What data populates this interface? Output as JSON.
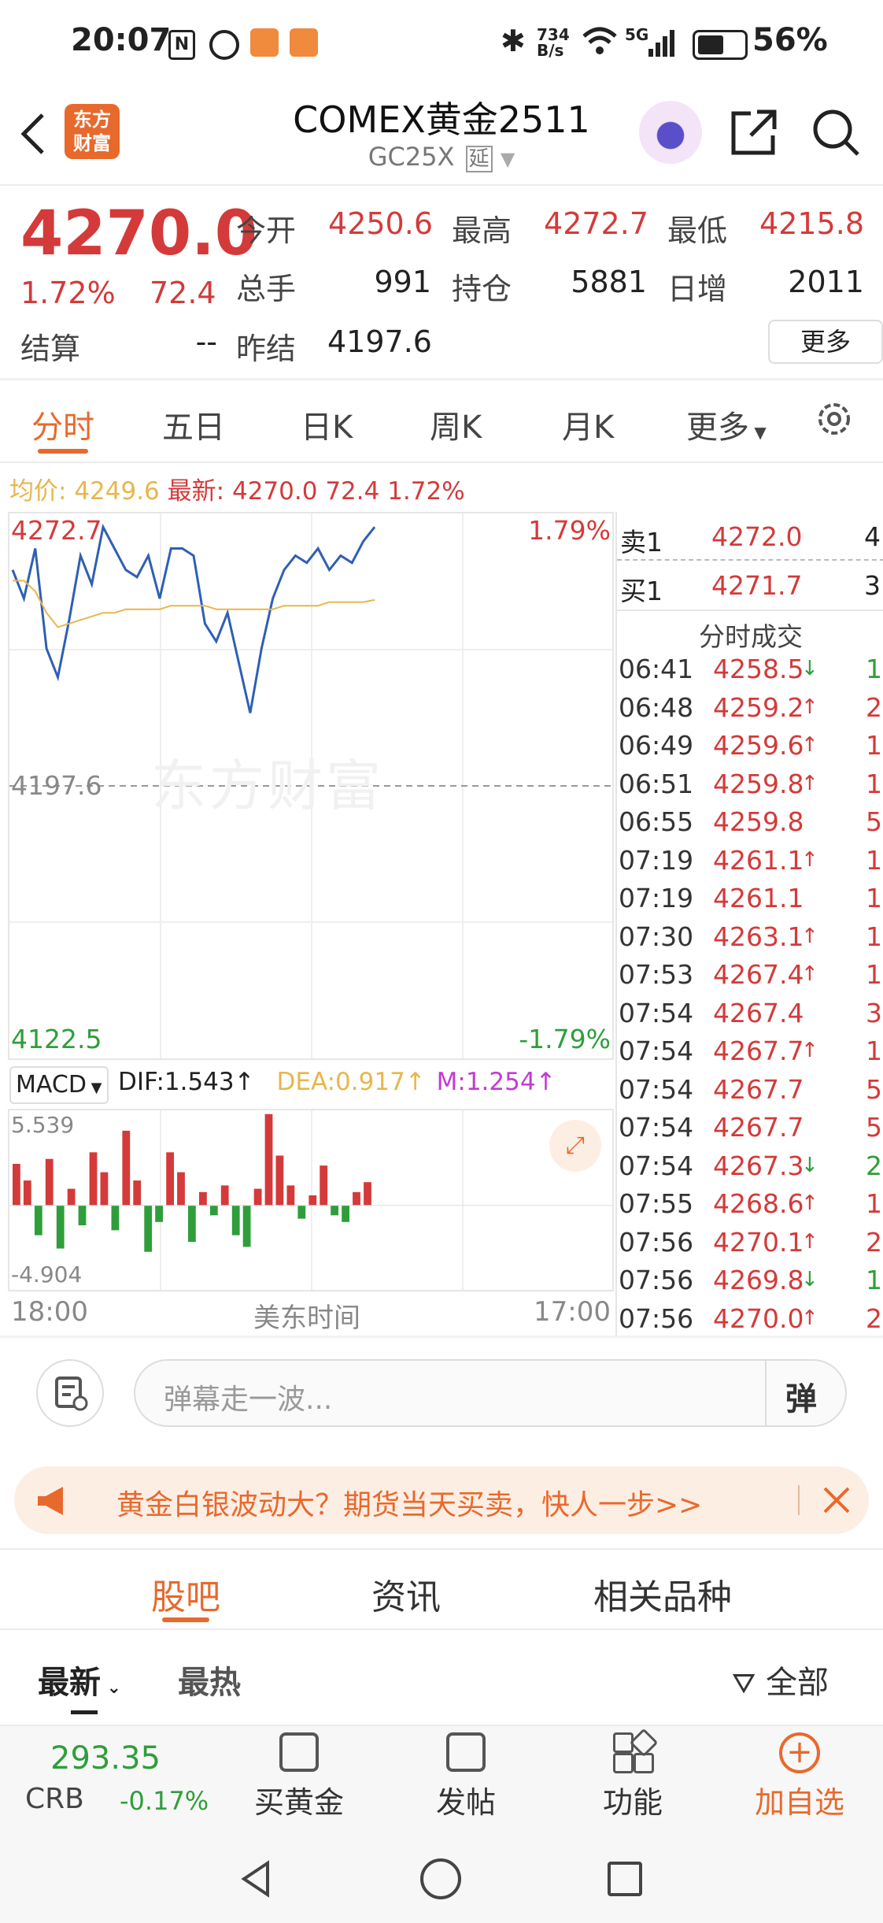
{
  "status_bar": {
    "time": "20:07",
    "speed_top": "734",
    "speed_unit": "B/s",
    "network": "5G",
    "battery": "56%"
  },
  "header": {
    "title": "COMEX黄金2511",
    "subtitle": "GC25X",
    "delay_badge": "延",
    "logo_line1": "东方",
    "logo_line2": "财富"
  },
  "quote": {
    "price": "4270.0",
    "change_pct": "1.72%",
    "change": "72.4",
    "settle_label": "结算",
    "settle_value": "--",
    "prev_settle_label": "昨结",
    "prev_settle_value": "4197.6",
    "open_label": "今开",
    "open_value": "4250.6",
    "high_label": "最高",
    "high_value": "4272.7",
    "low_label": "最低",
    "low_value": "4215.8",
    "volume_label": "总手",
    "volume_value": "991",
    "oi_label": "持仓",
    "oi_value": "5881",
    "daily_inc_label": "日增",
    "daily_inc_value": "2011",
    "more_button": "更多"
  },
  "tabs": [
    "分时",
    "五日",
    "日K",
    "周K",
    "月K",
    "更多"
  ],
  "info_line": {
    "avg_label": "均价:",
    "avg_value": "4249.6",
    "latest_label": "最新:",
    "latest_value": "4270.0",
    "change": "72.4",
    "change_pct": "1.72%"
  },
  "chart": {
    "top_price": "4272.7",
    "top_pct": "1.79%",
    "mid_price": "4197.6",
    "bottom_price": "4122.5",
    "bottom_pct": "-1.79%",
    "watermark": "东方财富",
    "x_start": "18:00",
    "x_mid": "美东时间",
    "x_end": "17:00"
  },
  "macd": {
    "selector": "MACD",
    "dif": "DIF:1.543",
    "dea": "DEA:0.917",
    "m": "M:1.254",
    "top": "5.539",
    "bottom": "-4.904"
  },
  "chart_data": {
    "type": "line",
    "title": "",
    "xlabel": "美东时间",
    "ylabel": "",
    "ylim": [
      4122.5,
      4272.7
    ],
    "reference_line": 4197.6,
    "series": [
      {
        "name": "最新",
        "values": [
          4258,
          4250,
          4264,
          4236,
          4228,
          4244,
          4262,
          4254,
          4270,
          4264,
          4258,
          4256,
          4262,
          4250,
          4264,
          4264,
          4262,
          4243,
          4238,
          4246,
          4232,
          4218,
          4236,
          4250,
          4258,
          4262,
          4260,
          4264,
          4258,
          4262,
          4260,
          4266,
          4270
        ]
      },
      {
        "name": "均价",
        "values": [
          4255,
          4255,
          4252,
          4246,
          4242,
          4243,
          4244,
          4245,
          4246,
          4246,
          4247,
          4247,
          4247,
          4247,
          4248,
          4248,
          4248,
          4248,
          4247,
          4247,
          4247,
          4247,
          4247,
          4247,
          4248,
          4248,
          4248,
          4248,
          4249,
          4249,
          4249,
          4249,
          4249.6
        ]
      }
    ],
    "macd_ylim": [
      -4.904,
      5.539
    ],
    "macd_bars": [
      2.5,
      1.5,
      -1.8,
      2.8,
      -2.6,
      1.0,
      -1.2,
      3.2,
      2.0,
      -1.5,
      4.5,
      1.5,
      -2.8,
      -1.0,
      3.2,
      2.0,
      -2.2,
      0.8,
      -0.6,
      1.2,
      -1.8,
      -2.5,
      1.0,
      5.5,
      3.0,
      1.2,
      -0.8,
      0.6,
      2.4,
      -0.6,
      -1.0,
      0.8,
      1.4
    ]
  },
  "order_book": {
    "ask_label": "卖1",
    "ask_price": "4272.0",
    "ask_vol": "4",
    "bid_label": "买1",
    "bid_price": "4271.7",
    "bid_vol": "3",
    "trades_title": "分时成交"
  },
  "trades": [
    {
      "time": "06:41",
      "price": "4258.5",
      "dir": "↓",
      "vol": "1"
    },
    {
      "time": "06:48",
      "price": "4259.2",
      "dir": "↑",
      "vol": "2"
    },
    {
      "time": "06:49",
      "price": "4259.6",
      "dir": "↑",
      "vol": "1"
    },
    {
      "time": "06:51",
      "price": "4259.8",
      "dir": "↑",
      "vol": "1"
    },
    {
      "time": "06:55",
      "price": "4259.8",
      "dir": "",
      "vol": "5"
    },
    {
      "time": "07:19",
      "price": "4261.1",
      "dir": "↑",
      "vol": "1"
    },
    {
      "time": "07:19",
      "price": "4261.1",
      "dir": "",
      "vol": "1"
    },
    {
      "time": "07:30",
      "price": "4263.1",
      "dir": "↑",
      "vol": "1"
    },
    {
      "time": "07:53",
      "price": "4267.4",
      "dir": "↑",
      "vol": "1"
    },
    {
      "time": "07:54",
      "price": "4267.4",
      "dir": "",
      "vol": "3"
    },
    {
      "time": "07:54",
      "price": "4267.7",
      "dir": "↑",
      "vol": "1"
    },
    {
      "time": "07:54",
      "price": "4267.7",
      "dir": "",
      "vol": "5"
    },
    {
      "time": "07:54",
      "price": "4267.7",
      "dir": "",
      "vol": "5"
    },
    {
      "time": "07:54",
      "price": "4267.3",
      "dir": "↓",
      "vol": "2"
    },
    {
      "time": "07:55",
      "price": "4268.6",
      "dir": "↑",
      "vol": "1"
    },
    {
      "time": "07:56",
      "price": "4270.1",
      "dir": "↑",
      "vol": "2"
    },
    {
      "time": "07:56",
      "price": "4269.8",
      "dir": "↓",
      "vol": "1"
    },
    {
      "time": "07:56",
      "price": "4270.0",
      "dir": "↑",
      "vol": "2"
    }
  ],
  "comment": {
    "placeholder": "弹幕走一波...",
    "send_label": "弹"
  },
  "banner": {
    "text": "黄金白银波动大？期货当天买卖，快人一步>>"
  },
  "section_tabs": [
    "股吧",
    "资讯",
    "相关品种"
  ],
  "sort_tabs": {
    "latest": "最新",
    "hot": "最热",
    "filter": "全部"
  },
  "bottom_bar": {
    "ticker_value": "293.35",
    "ticker_name": "CRB",
    "ticker_change": "-0.17%",
    "buy_gold": "买黄金",
    "post": "发帖",
    "function": "功能",
    "add_watch": "加自选"
  },
  "colors": {
    "up": "#d43a3a",
    "down": "#2f9e3a",
    "accent": "#e8692c",
    "avg_line": "#e8b64d",
    "price_line": "#2f5fb4"
  }
}
